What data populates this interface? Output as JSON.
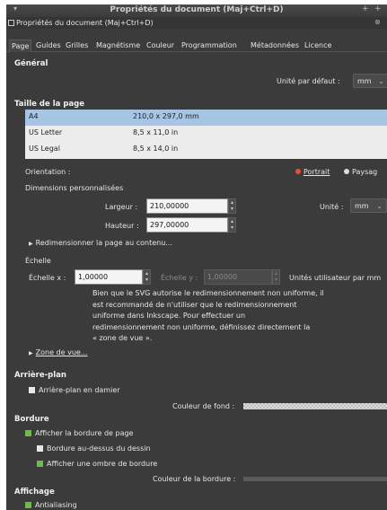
{
  "window": {
    "title": "Propriétés du document (Maj+Ctrl+D)",
    "menu_glyph": "▾",
    "buttons": [
      "+",
      "+"
    ]
  },
  "dock": {
    "label": "Propriétés du document (Maj+Ctrl+D)",
    "close_glyph": "⊗"
  },
  "tabs": [
    "Page",
    "Guides",
    "Grilles",
    "Magnétisme",
    "Couleur",
    "Programmation",
    "Métadonnées",
    "Licence"
  ],
  "general": {
    "heading": "Général",
    "unit_label": "Unité par défaut :",
    "unit_value": "mm"
  },
  "page_size": {
    "heading": "Taille de la page",
    "rows": [
      {
        "name": "A4",
        "size": "210,0 x 297,0 mm",
        "selected": true
      },
      {
        "name": "US Letter",
        "size": "8,5 x 11,0 in",
        "selected": false
      },
      {
        "name": "US Legal",
        "size": "8,5 x 14,0 in",
        "selected": false
      }
    ]
  },
  "orientation": {
    "label": "Orientation :",
    "portrait": "Portrait",
    "landscape": "Paysag"
  },
  "custom": {
    "heading": "Dimensions personnalisées",
    "width_label": "Largeur :",
    "width_value": "210,00000",
    "height_label": "Hauteur :",
    "height_value": "297,00000",
    "unit_label": "Unité :",
    "unit_value": "mm",
    "resize": "Redimensionner la page au contenu..."
  },
  "scale": {
    "heading": "Échelle",
    "x_label": "Échelle x :",
    "x_value": "1,00000",
    "y_label": "Échelle y :",
    "y_value": "1,00000",
    "units_label": "Unités utilisateur par mm",
    "note": [
      "Bien que le SVG autorise le redimensionnement non uniforme, il",
      "est recommandé de n'utiliser que le redimensionnement",
      "uniforme dans Inkscape. Pour effectuer un",
      "redimensionnement non uniforme, définissez directement la",
      "« zone de vue »."
    ],
    "viewbox": "Zone de vue..."
  },
  "background": {
    "heading": "Arrière-plan",
    "checker": "Arrière-plan en damier",
    "color_label": "Couleur de fond :"
  },
  "border": {
    "heading": "Bordure",
    "show": "Afficher la bordure de page",
    "on_top": "Bordure au-dessus du dessin",
    "shadow": "Afficher une ombre de bordure",
    "color_label": "Couleur de la bordure :"
  },
  "display": {
    "heading": "Affichage",
    "antialias": "Antialiasing"
  },
  "colors": {
    "window_bg": "#3b3b3b",
    "selection": "#a6c4e4",
    "check_green": "#6dbd45",
    "radio_orange": "#e8502a"
  }
}
